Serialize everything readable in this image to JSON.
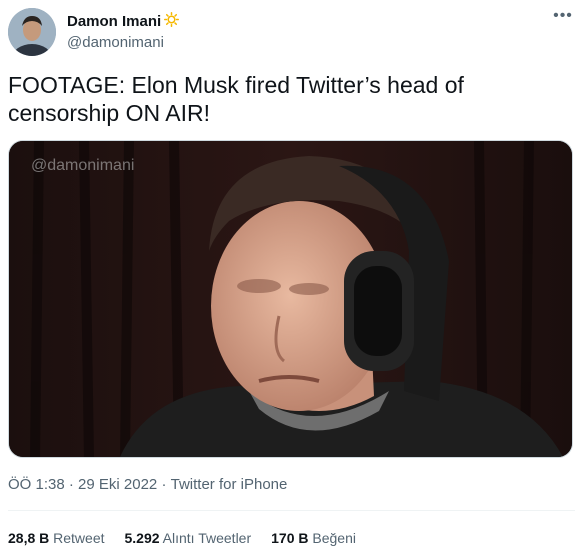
{
  "author": {
    "display_name": "Damon Imani",
    "handle": "@damonimani",
    "badge_icon": "sun-icon"
  },
  "tweet": {
    "text": "FOOTAGE: Elon Musk fired Twitter’s head of censorship ON AIR!",
    "media_watermark": "@damonimani"
  },
  "meta": {
    "time": "ÖÖ 1:38",
    "separator": "·",
    "date": "29 Eki 2022",
    "source": "Twitter for iPhone"
  },
  "stats": {
    "retweets_count": "28,8 B",
    "retweets_label": "Retweet",
    "quotes_count": "5.292",
    "quotes_label": "Alıntı Tweetler",
    "likes_count": "170 B",
    "likes_label": "Beğeni"
  },
  "colors": {
    "text_primary": "#0f1419",
    "text_secondary": "#536471",
    "badge": "#f5b800"
  }
}
